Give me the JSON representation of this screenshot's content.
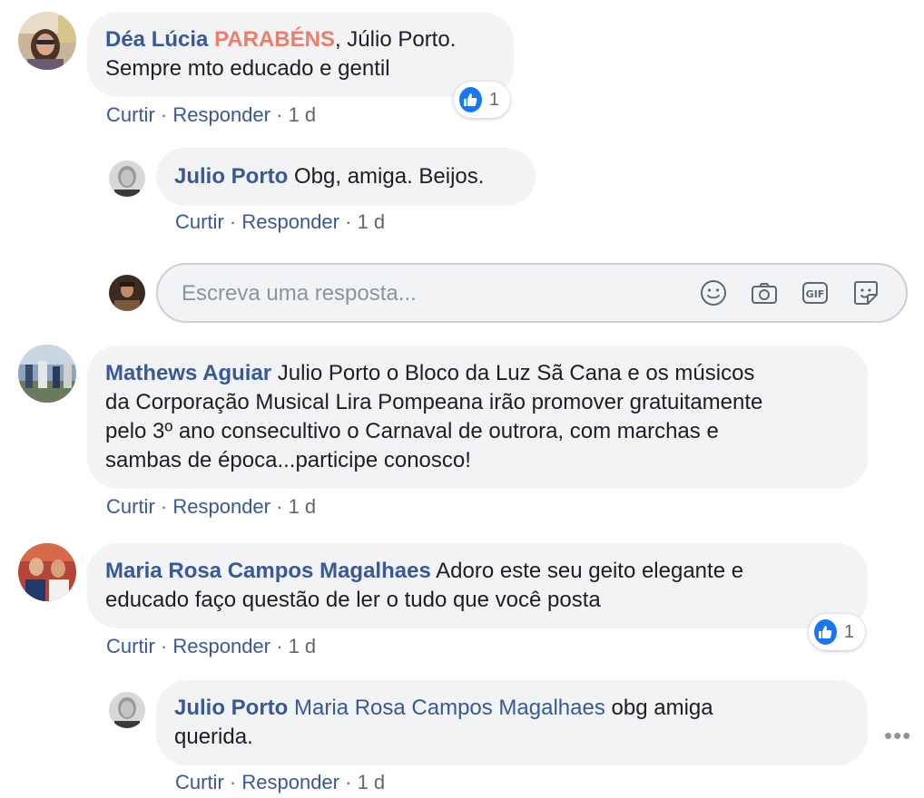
{
  "comments": [
    {
      "author": "Déa Lúcia",
      "highlight": "PARABÉNS",
      "text_after_highlight": ", Júlio Porto.",
      "text_line2": "Sempre mto educado e gentil",
      "reaction_count": "1",
      "actions": {
        "like": "Curtir",
        "reply": "Responder",
        "sep": "·",
        "time": "1 d"
      }
    },
    {
      "author": "Julio Porto",
      "text": " Obg, amiga. Beijos.",
      "actions": {
        "like": "Curtir",
        "reply": "Responder",
        "sep": "·",
        "time": "1 d"
      }
    },
    {
      "author": "Mathews Aguiar",
      "text_line1": " Julio Porto o Bloco da Luz Sã Cana e os músicos",
      "text_line2": "da Corporação Musical Lira Pompeana irão promover gratuitamente",
      "text_line3": "pelo 3º ano consecultivo o Carnaval de outrora, com marchas e",
      "text_line4": "sambas de época...participe conosco!",
      "actions": {
        "like": "Curtir",
        "reply": "Responder",
        "sep": "·",
        "time": "1 d"
      }
    },
    {
      "author": "Maria Rosa Campos Magalhaes",
      "text_line1": " Adoro este seu geito elegante e",
      "text_line2": "educado faço questão de ler o tudo que você posta",
      "reaction_count": "1",
      "actions": {
        "like": "Curtir",
        "reply": "Responder",
        "sep": "·",
        "time": "1 d"
      }
    },
    {
      "author": "Julio Porto",
      "tagged": "Maria Rosa Campos Magalhaes",
      "text_line1": " obg amiga",
      "text_line2": "querida.",
      "actions": {
        "like": "Curtir",
        "reply": "Responder",
        "sep": "·",
        "time": "1 d"
      }
    }
  ],
  "reply_box": {
    "placeholder": "Escreva uma resposta...",
    "icons": [
      "emoji-icon",
      "camera-icon",
      "gif-icon",
      "sticker-icon"
    ],
    "gif_label": "GIF"
  },
  "colors": {
    "link": "#385898",
    "highlight": "#e9806c",
    "bubble": "#f2f3f5",
    "like": "#1877f2"
  }
}
